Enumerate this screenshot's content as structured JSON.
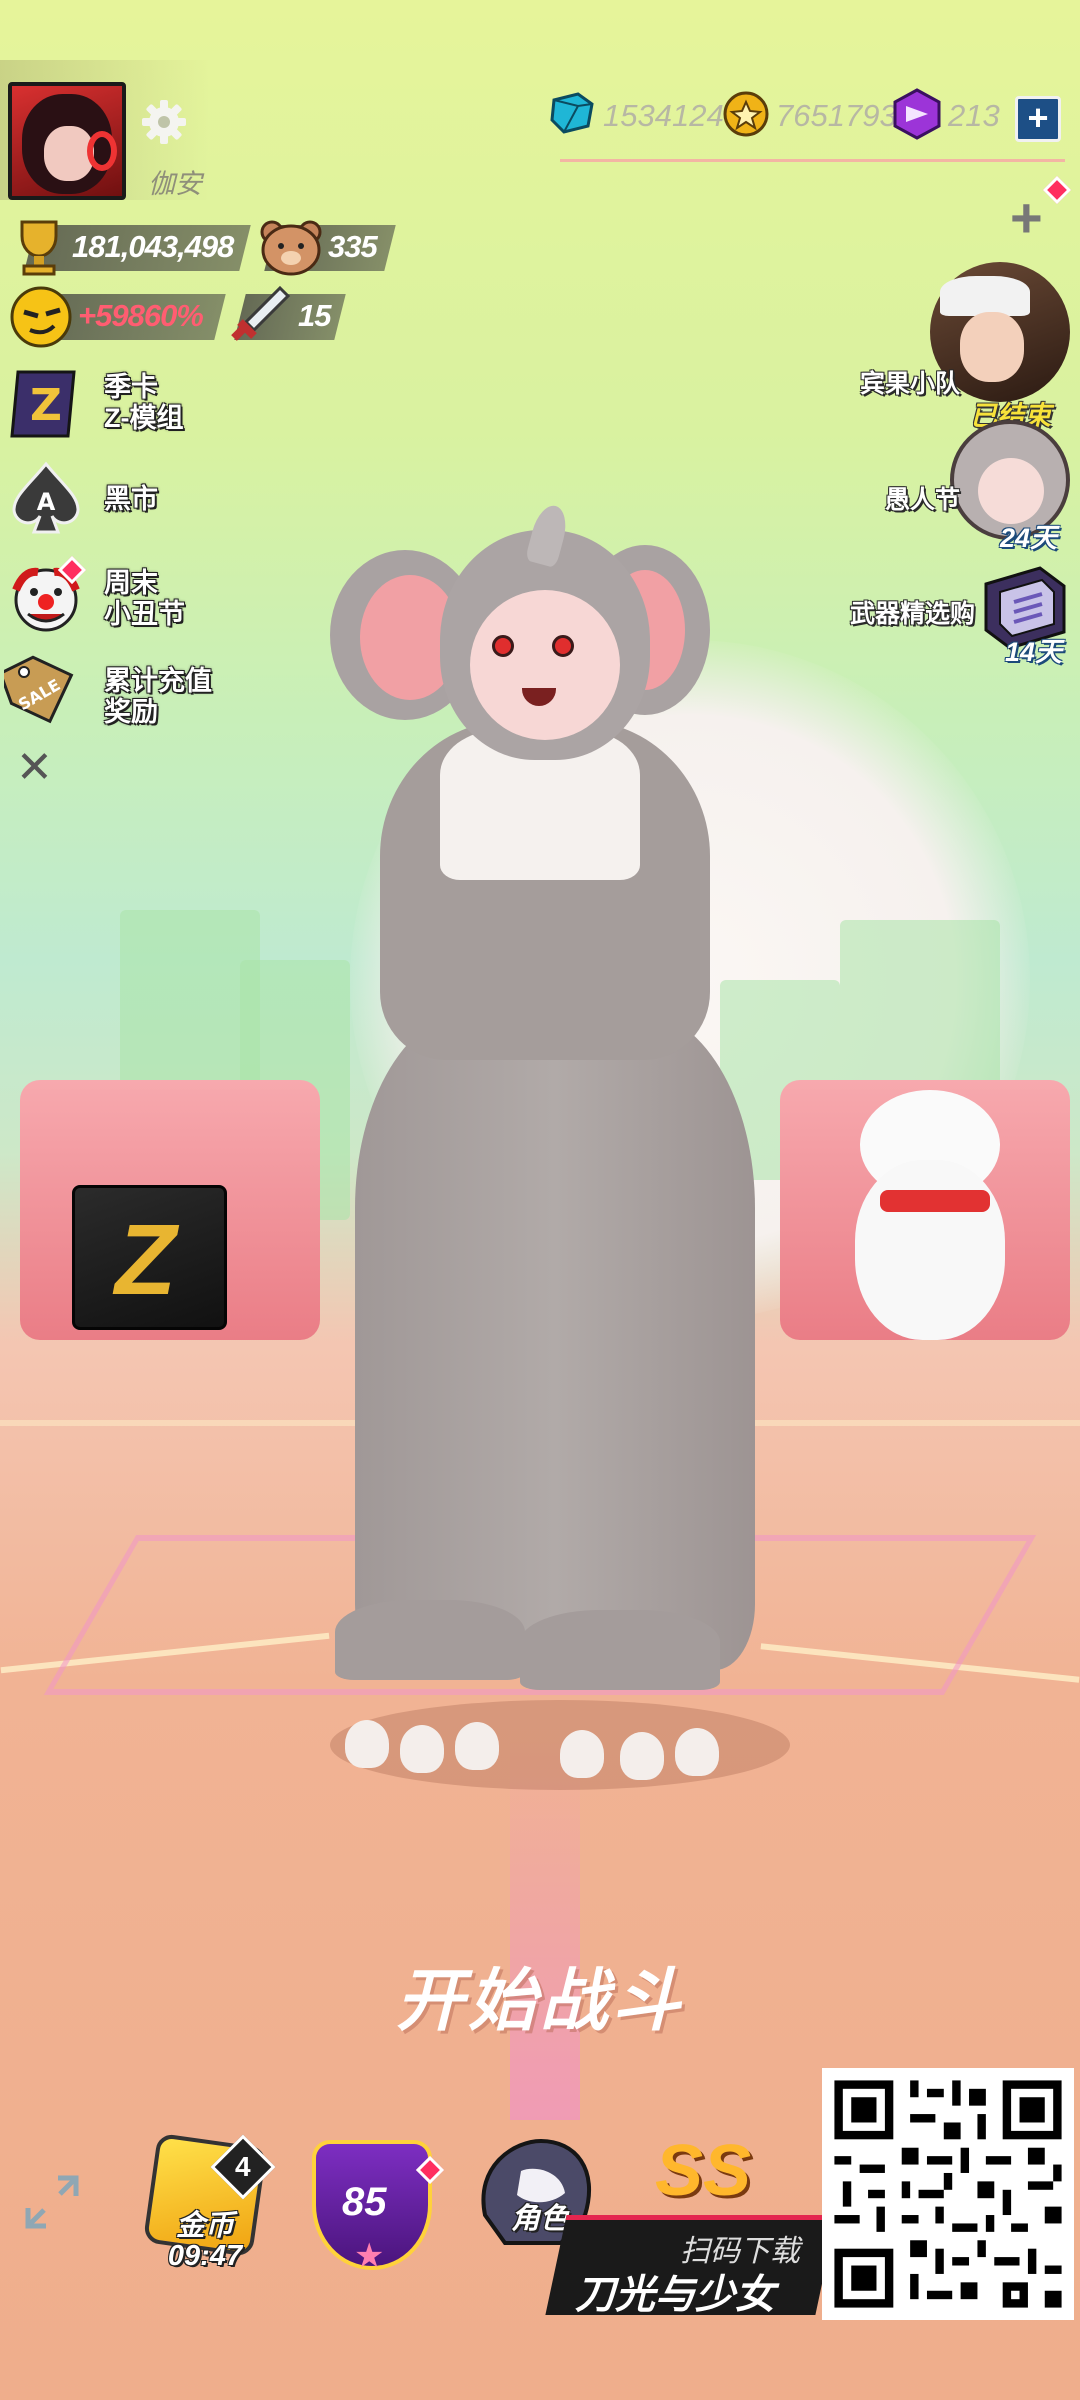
{
  "player": {
    "name": "伽安",
    "trophies": "181,043,498",
    "bear_count": "335",
    "boost_percent": "+59860%",
    "sword_count": "15"
  },
  "currencies": [
    {
      "icon": "crystal-icon",
      "value": "1534124"
    },
    {
      "icon": "gold-coin-icon",
      "value": "7651793"
    },
    {
      "icon": "purple-gem-icon",
      "value": "213"
    }
  ],
  "left_menu": [
    {
      "id": "season-card",
      "icon": "z-card-icon",
      "label": "季卡\nZ-模组"
    },
    {
      "id": "black-market",
      "icon": "spade-ace-icon",
      "label": "黑市"
    },
    {
      "id": "clown-festival",
      "icon": "clown-icon",
      "label": "周末\n小丑节"
    },
    {
      "id": "recharge-reward",
      "icon": "sale-tag-icon",
      "label": "累计充值\n奖励"
    }
  ],
  "right_events": [
    {
      "id": "bingo-squad",
      "label": "宾果小队",
      "status": "已结束"
    },
    {
      "id": "april-fools",
      "label": "愚人节",
      "status": "24天"
    },
    {
      "id": "weapon-select",
      "label": "武器精选购",
      "status": "14天"
    }
  ],
  "start_button": "开始战斗",
  "bottom": {
    "coin_badge_count": "4",
    "coin_label": "金币",
    "coin_timer": "09:47",
    "level": "85",
    "role_label": "角色",
    "rank": "SS"
  },
  "promo": {
    "line1": "扫码下载",
    "line2": "刀光与少女"
  },
  "colors": {
    "accent_red": "#ff5d71",
    "event_yellow": "#f7e23a",
    "plus_blue": "#1d4f86"
  }
}
